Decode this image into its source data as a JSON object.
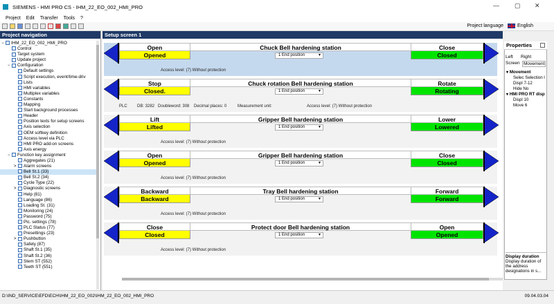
{
  "window": {
    "title": "SIEMENS - HMI PRO CS - IHM_22_EO_002_HMI_PRO",
    "controls": [
      "—",
      "▢",
      "✕"
    ]
  },
  "menu": [
    "Project",
    "Edit",
    "Transfer",
    "Tools",
    "?"
  ],
  "toolbar": {
    "icons": [
      "new-icon",
      "open-icon",
      "save-icon",
      "cut-icon",
      "copy-icon",
      "paste-icon",
      "delete-icon",
      "generate-icon",
      "settings-icon",
      "tools-icon",
      "help-icon"
    ],
    "language_label": "Project language",
    "language_value": "English"
  },
  "nav": {
    "title": "Project navigation",
    "items": [
      {
        "label": "IHM_22_EO_002_HMI_PRO",
        "level": 0,
        "expander": "−"
      },
      {
        "label": "Control",
        "level": 1
      },
      {
        "label": "Target system",
        "level": 1
      },
      {
        "label": "Update project",
        "level": 1
      },
      {
        "label": "Configuration",
        "level": 1,
        "expander": "−"
      },
      {
        "label": "Default settings",
        "level": 2
      },
      {
        "label": "Script execution, event/time-driv",
        "level": 2
      },
      {
        "label": "Lists",
        "level": 2
      },
      {
        "label": "HMI variables",
        "level": 2
      },
      {
        "label": "Multiplex variables",
        "level": 2
      },
      {
        "label": "Constants",
        "level": 2
      },
      {
        "label": "Mapping",
        "level": 2
      },
      {
        "label": "Start background processes",
        "level": 2
      },
      {
        "label": "Header",
        "level": 2
      },
      {
        "label": "Position texts for setup screens",
        "level": 2
      },
      {
        "label": "Axis selection",
        "level": 2
      },
      {
        "label": "OEM softkey definition",
        "level": 2
      },
      {
        "label": "Access level via PLC",
        "level": 2
      },
      {
        "label": "HMI PRO add-on screens",
        "level": 2
      },
      {
        "label": "Axis energy",
        "level": 2
      },
      {
        "label": "Function key assignment",
        "level": 1,
        "expander": "−"
      },
      {
        "label": "Aggregates   (21)",
        "level": 2
      },
      {
        "label": "Alarm screens",
        "level": 2,
        "expander": ">"
      },
      {
        "label": "Bell St.1   (33)",
        "level": 2,
        "selected": true
      },
      {
        "label": "Bell St.2   (34)",
        "level": 2
      },
      {
        "label": "Cycle Type   (22)",
        "level": 2
      },
      {
        "label": "Diagnostic screens",
        "level": 2,
        "expander": ">"
      },
      {
        "label": "Help   (81)",
        "level": 2
      },
      {
        "label": "Language   (86)",
        "level": 2
      },
      {
        "label": "Loading St.   (31)",
        "level": 2
      },
      {
        "label": "Monitoring   (24)",
        "level": 2
      },
      {
        "label": "Password   (75)",
        "level": 2
      },
      {
        "label": "Plc. settings   (78)",
        "level": 2
      },
      {
        "label": "PLC Status   (77)",
        "level": 2
      },
      {
        "label": "Presettings   (23)",
        "level": 2
      },
      {
        "label": "Pushbutton",
        "level": 2,
        "expander": ">"
      },
      {
        "label": "Safety   (87)",
        "level": 2
      },
      {
        "label": "Shaft St.1   (35)",
        "level": 2
      },
      {
        "label": "Shaft St.2   (36)",
        "level": 2
      },
      {
        "label": "Stem ST   (552)",
        "level": 2
      },
      {
        "label": "Teeth ST   (551)",
        "level": 2
      }
    ]
  },
  "main": {
    "title": "Setup screen 1",
    "rows": [
      {
        "left_label": "Open",
        "left_value": "Opened",
        "middle": "Chuck Bell hardening station",
        "select": "1 End position",
        "right_label": "Close",
        "right_value": "Closed",
        "access": "Access level: (7) Without protection",
        "highlight": true
      },
      {
        "left_label": "Stop",
        "left_value": "Closed.",
        "middle": "Chuck rotation  Bell hardening station",
        "select": "1 End position",
        "right_label": "Rotate",
        "right_value": "Rotating",
        "access": "Access level: (7) Without protection",
        "plc": [
          "PLC",
          "DB: 3282",
          "Doubleword: 308",
          "Decimal places: 0",
          "Measurement unit:"
        ]
      },
      {
        "left_label": "Lift",
        "left_value": "Lifted",
        "middle": "Gripper Bell hardening station",
        "select": "1 End position",
        "right_label": "Lower",
        "right_value": "Lowered",
        "access": "Access level: (7) Without protection"
      },
      {
        "left_label": "Open",
        "left_value": "Opened",
        "middle": "Gripper  Bell hardening station",
        "select": "1 End position",
        "right_label": "Close",
        "right_value": "Closed",
        "access": "Access level: (7) Without protection"
      },
      {
        "left_label": "Backward",
        "left_value": "Backward",
        "middle": "Tray  Bell hardening station",
        "select": "1 End position",
        "right_label": "Forward",
        "right_value": "Forward",
        "access": "Access level: (7) Without protection"
      },
      {
        "left_label": "Close",
        "left_value": "Closed",
        "middle": "Protect door Bell hardening station",
        "select": "1 End position",
        "right_label": "Open",
        "right_value": "Opened",
        "access": "Access level: (7) Without protection"
      }
    ]
  },
  "properties": {
    "title": "Properties",
    "tabs": [
      "Left",
      "Right",
      "Screen",
      "Movement"
    ],
    "groups": [
      {
        "name": "Movement",
        "rows": [
          "Selec Selection l",
          "Displ  7-12",
          "Hide  No"
        ]
      },
      {
        "name": "HMI PRO RT disp",
        "rows": [
          "Displ  10",
          "Move  6"
        ]
      }
    ],
    "desc_title": "Display duration",
    "desc_text": "Display duration of the address designations in s..."
  },
  "status": {
    "path": "D:\\IND_SERVICE\\EFD\\ECH\\IHM_22_EO_002\\IHM_22_EO_002_HMI_PRO",
    "date": "09.04.03.04"
  },
  "colors": {
    "nav_header": "#1f3a66",
    "arrow": "#1424c8",
    "yellow": "#ffff00",
    "green": "#00e400",
    "highlight_row": "#c5d9ee"
  }
}
